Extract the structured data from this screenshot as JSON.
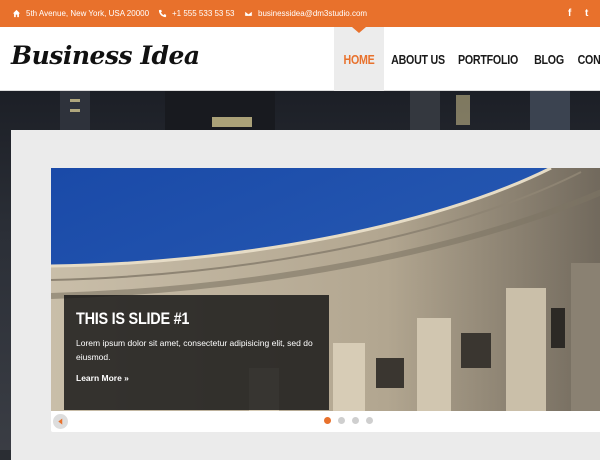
{
  "topbar": {
    "address": "5th Avenue, New York, USA 20000",
    "phone": "+1 555 533 53 53",
    "email": "businessidea@dm3studio.com",
    "social": [
      "f",
      "t"
    ]
  },
  "header": {
    "logo": "Business Idea",
    "nav": [
      "HOME",
      "ABOUT US",
      "PORTFOLIO",
      "BLOG",
      "CON"
    ],
    "active_index": 0
  },
  "slider": {
    "title": "THIS IS SLIDE #1",
    "text": "Lorem ipsum dolor sit amet, consectetur adipisicing elit, sed do eiusmod.",
    "more": "Learn More »",
    "slide_count": 4,
    "active_slide": 1
  },
  "colors": {
    "accent": "#e8712c",
    "sky": "#1f4fa3",
    "stone": "#b9ad99"
  }
}
